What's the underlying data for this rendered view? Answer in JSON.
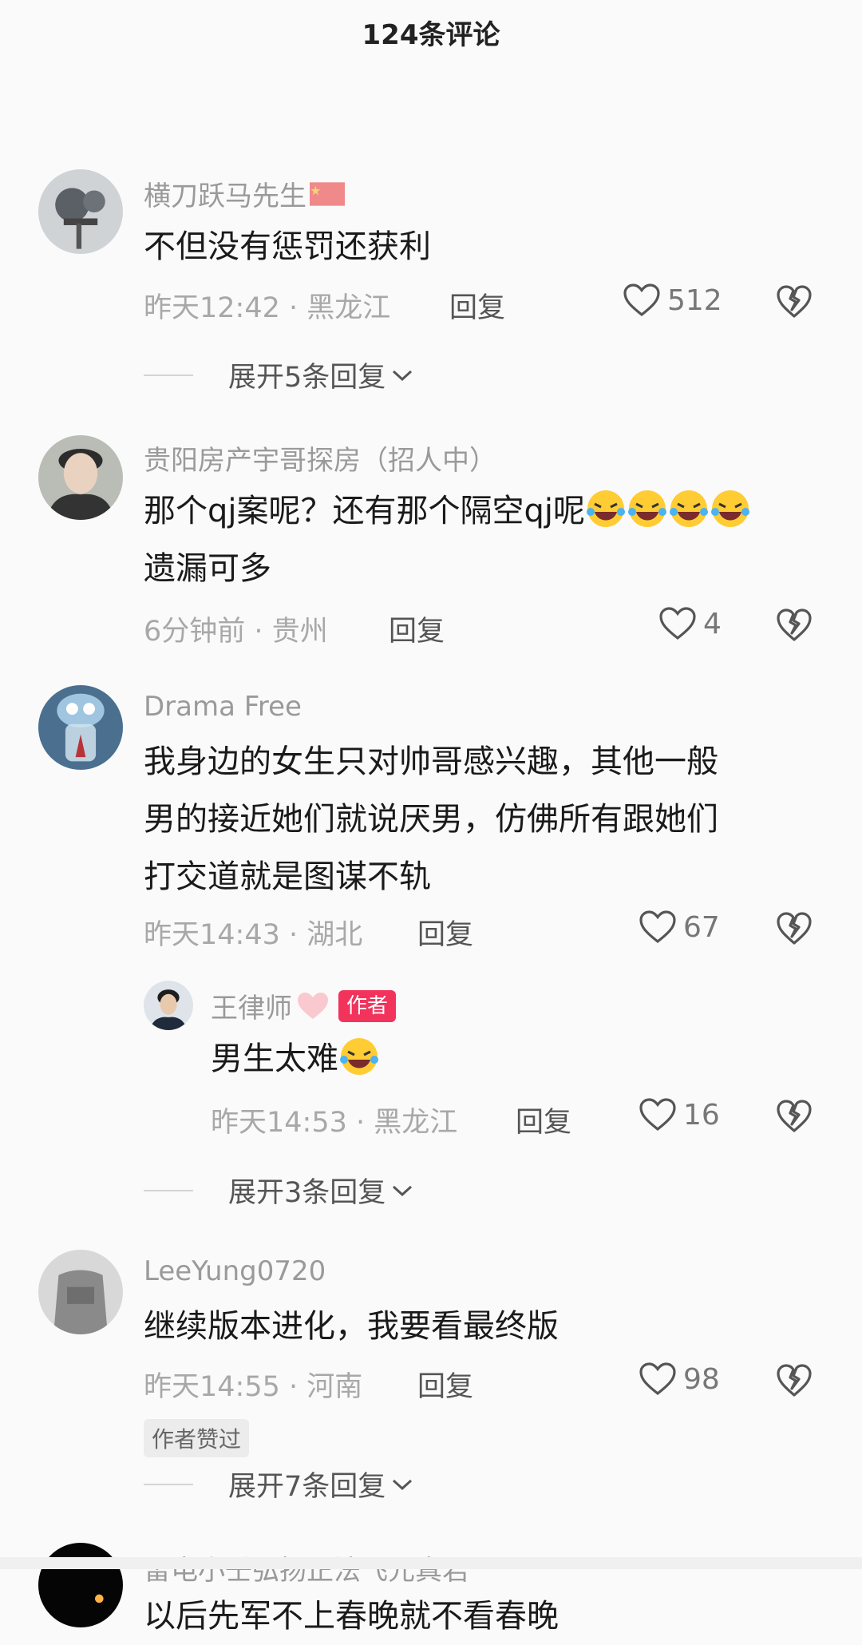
{
  "header": {
    "title": "124条评论"
  },
  "comments": [
    {
      "name": "横刀跃马先生",
      "text_lines": [
        "不但没有惩罚还获利"
      ],
      "time": "昨天12:42",
      "location": "黑龙江",
      "reply_label": "回复",
      "likes": "512",
      "expand": "展开5条回复"
    },
    {
      "name": "贵阳房产宇哥探房（招人中）",
      "text_lines": [
        "那个qj案呢？还有那个隔空qj呢",
        "遗漏可多"
      ],
      "time": "6分钟前",
      "location": "贵州",
      "reply_label": "回复",
      "likes": "4"
    },
    {
      "name": "Drama Free",
      "text_lines": [
        "我身边的女生只对帅哥感兴趣，其他一般",
        "男的接近她们就说厌男，仿佛所有跟她们",
        "打交道就是图谋不轨"
      ],
      "time": "昨天14:43",
      "location": "湖北",
      "reply_label": "回复",
      "likes": "67",
      "reply": {
        "name": "王律师",
        "badge": "作者",
        "text": "男生太难",
        "time": "昨天14:53",
        "location": "黑龙江",
        "reply_label": "回复",
        "likes": "16"
      },
      "expand": "展开3条回复"
    },
    {
      "name": "LeeYung0720",
      "text_lines": [
        "继续版本进化，我要看最终版"
      ],
      "time": "昨天14:55",
      "location": "河南",
      "reply_label": "回复",
      "likes": "98",
      "tag": "作者赞过",
      "expand": "展开7条回复"
    },
    {
      "name": "雷电小壬弘扬正法飞元真君",
      "text_lines": [
        "以后先军不上春晚就不看春晚"
      ]
    }
  ],
  "separator": "·",
  "colors": {
    "accent": "#f2335c",
    "meta": "#a8a8a8",
    "name": "#9a9a9a"
  },
  "icons": [
    "heart-outline-icon",
    "broken-heart-icon",
    "chevron-down-icon",
    "china-flag-icon",
    "pink-heart-icon",
    "laughing-emoji-icon"
  ]
}
